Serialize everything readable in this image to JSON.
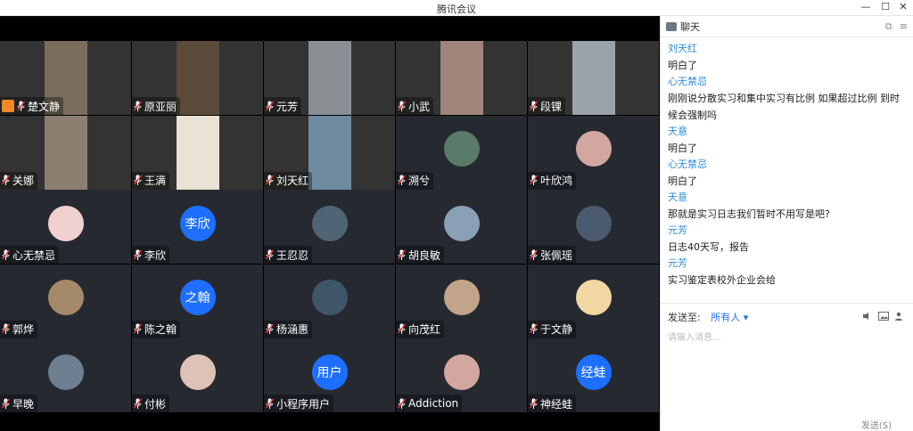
{
  "window": {
    "title": "腾讯会议"
  },
  "participants": [
    {
      "name": "楚文静",
      "type": "camera",
      "host": true
    },
    {
      "name": "原亚丽",
      "type": "camera"
    },
    {
      "name": "元芳",
      "type": "camera"
    },
    {
      "name": "小武",
      "type": "camera"
    },
    {
      "name": "段锞",
      "type": "camera"
    },
    {
      "name": "关娜",
      "type": "camera"
    },
    {
      "name": "王满",
      "type": "camera"
    },
    {
      "name": "刘天红",
      "type": "camera"
    },
    {
      "name": "溯兮",
      "type": "avatar"
    },
    {
      "name": "叶欣鸿",
      "type": "avatar"
    },
    {
      "name": "心无禁忌",
      "type": "avatar"
    },
    {
      "name": "李欣",
      "type": "text",
      "avatar_text": "李欣"
    },
    {
      "name": "王忍忍",
      "type": "avatar"
    },
    {
      "name": "胡良敏",
      "type": "avatar"
    },
    {
      "name": "张佩瑶",
      "type": "avatar"
    },
    {
      "name": "郭烨",
      "type": "avatar"
    },
    {
      "name": "陈之翰",
      "type": "text",
      "avatar_text": "之翰"
    },
    {
      "name": "杨涵惠",
      "type": "avatar"
    },
    {
      "name": "向茂红",
      "type": "avatar"
    },
    {
      "name": "于文静",
      "type": "avatar"
    },
    {
      "name": "早晚",
      "type": "avatar"
    },
    {
      "name": "付彬",
      "type": "avatar"
    },
    {
      "name": "小程序用户",
      "type": "text",
      "avatar_text": "用户"
    },
    {
      "name": "Addiction",
      "type": "avatar"
    },
    {
      "name": "神经蛙",
      "type": "text",
      "avatar_text": "经蛙"
    }
  ],
  "chat": {
    "title": "聊天",
    "messages": [
      {
        "sender": "刘天红",
        "text": "明白了"
      },
      {
        "sender": "心无禁忌",
        "text": "刚刚说分散实习和集中实习有比例  如果超过比例 到时候会强制吗"
      },
      {
        "sender": "天意",
        "text": "明白了"
      },
      {
        "sender": "心无禁忌",
        "text": "明白了"
      },
      {
        "sender": "天意",
        "text": "那就是实习日志我们暂时不用写是吧?"
      },
      {
        "sender": "元芳",
        "text": "日志40天写，报告"
      },
      {
        "sender": "元芳",
        "text": "实习鉴定表校外企业会给"
      }
    ],
    "send_to_label": "发送至:",
    "send_to_value": "所有人",
    "input_placeholder": "请输入消息...",
    "send_label": "发送(S)"
  },
  "colors": {
    "accent": "#1e6fff",
    "sender": "#2f8bd6",
    "tile_bg": "#262a30"
  }
}
